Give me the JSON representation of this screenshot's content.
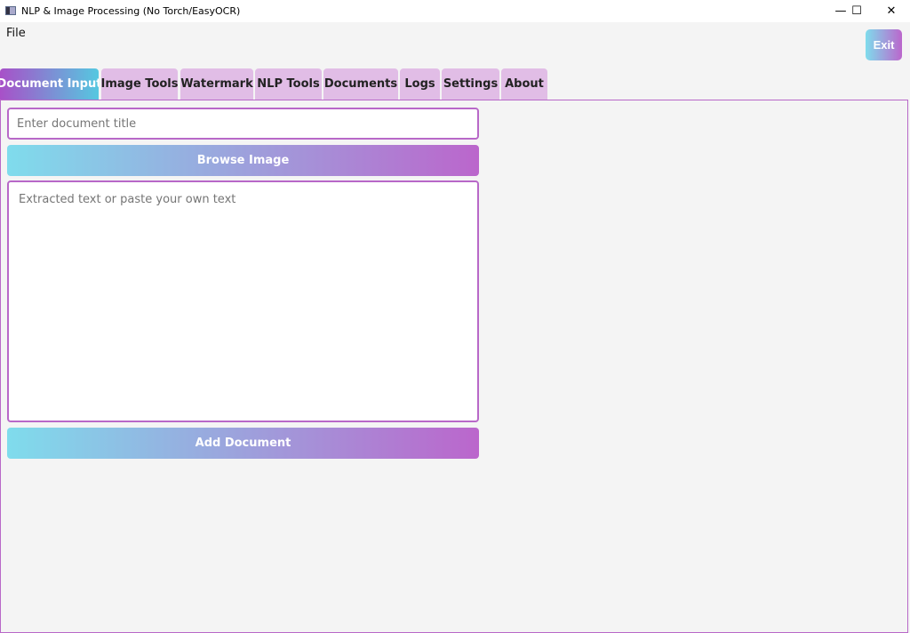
{
  "window": {
    "title": "NLP & Image Processing (No Torch/EasyOCR)",
    "minimize": "—",
    "maximize": "☐",
    "close": "✕"
  },
  "menu": {
    "file": "File"
  },
  "exit_label": "Exit",
  "tabs": [
    {
      "label": "Document Input"
    },
    {
      "label": "Image Tools"
    },
    {
      "label": "Watermark"
    },
    {
      "label": "NLP Tools"
    },
    {
      "label": "Documents"
    },
    {
      "label": "Logs"
    },
    {
      "label": "Settings"
    },
    {
      "label": "About"
    }
  ],
  "form": {
    "title_placeholder": "Enter document title",
    "browse_label": "Browse Image",
    "text_placeholder": "Extracted text or paste your own text",
    "add_label": "Add Document"
  },
  "colors": {
    "accent": "#b868c8",
    "gradient_start": "#7fdcec",
    "gradient_end": "#bb66cc"
  }
}
